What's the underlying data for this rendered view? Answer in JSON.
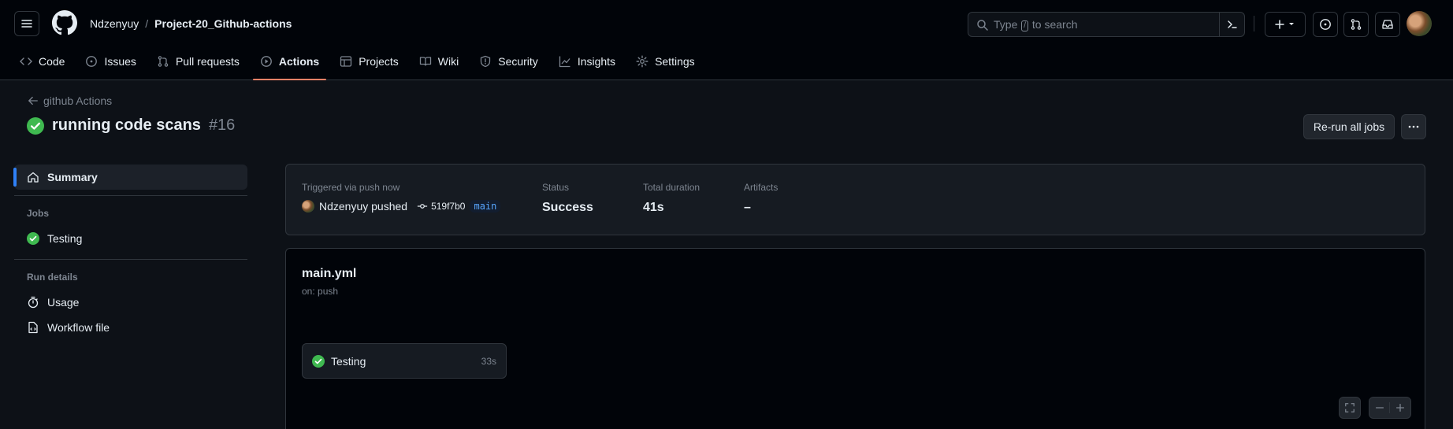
{
  "header": {
    "owner": "Ndzenyuy",
    "separator": "/",
    "repo": "Project-20_Github-actions",
    "search": {
      "prefix": "Type",
      "key": "/",
      "suffix": "to search"
    }
  },
  "tabs": [
    {
      "label": "Code",
      "icon": "code-icon"
    },
    {
      "label": "Issues",
      "icon": "issue-icon"
    },
    {
      "label": "Pull requests",
      "icon": "pull-request-icon"
    },
    {
      "label": "Actions",
      "icon": "play-icon",
      "active": true
    },
    {
      "label": "Projects",
      "icon": "table-icon"
    },
    {
      "label": "Wiki",
      "icon": "book-icon"
    },
    {
      "label": "Security",
      "icon": "shield-icon"
    },
    {
      "label": "Insights",
      "icon": "graph-icon"
    },
    {
      "label": "Settings",
      "icon": "gear-icon"
    }
  ],
  "run": {
    "back_label": "github Actions",
    "title": "running code scans",
    "number": "#16",
    "rerun_label": "Re-run all jobs"
  },
  "sidebar": {
    "summary": "Summary",
    "jobs_heading": "Jobs",
    "jobs": [
      "Testing"
    ],
    "details_heading": "Run details",
    "usage": "Usage",
    "workflow_file": "Workflow file"
  },
  "summary": {
    "trigger_label": "Triggered via push now",
    "actor": "Ndzenyuy pushed",
    "sha": "519f7b0",
    "branch": "main",
    "status_label": "Status",
    "status_value": "Success",
    "duration_label": "Total duration",
    "duration_value": "41s",
    "artifacts_label": "Artifacts",
    "artifacts_value": "–"
  },
  "workflow": {
    "file": "main.yml",
    "on": "on: push",
    "job_name": "Testing",
    "job_duration": "33s"
  },
  "colors": {
    "success": "#3fb950",
    "accent_underline": "#f78166",
    "branch": "#58a6ff",
    "selected_bar": "#2f81f7"
  }
}
